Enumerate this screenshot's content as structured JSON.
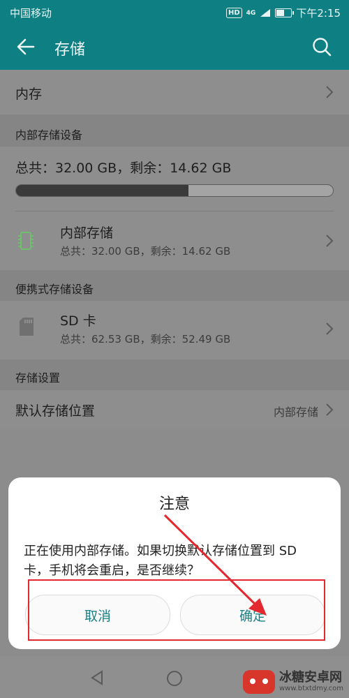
{
  "status_bar": {
    "carrier": "中国移动",
    "hd": "HD",
    "signal_text": "4G",
    "time": "下午2:15"
  },
  "app_bar": {
    "title": "存储",
    "back_icon": "arrow-left-icon",
    "search_icon": "search-icon"
  },
  "memory_row": {
    "label": "内存"
  },
  "internal_section": {
    "header": "内部存储设备",
    "summary": "总共：32.00 GB，剩余：14.62 GB",
    "used_fraction": 0.543,
    "item": {
      "name": "内部存储",
      "detail": "总共：32.00 GB，剩余：14.62 GB"
    }
  },
  "portable_section": {
    "header": "便携式存储设备",
    "item": {
      "name": "SD 卡",
      "detail": "总共：62.53 GB，剩余：52.49 GB"
    }
  },
  "settings_section": {
    "header": "存储设置",
    "default_location": {
      "label": "默认存储位置",
      "value": "内部存储"
    }
  },
  "dialog": {
    "title": "注意",
    "message": "正在使用内部存储。如果切换默认存储位置到 SD 卡，手机将会重启，是否继续？",
    "cancel": "取消",
    "confirm": "确定"
  },
  "watermark": {
    "name": "冰糖安卓网",
    "url": "www.btxtdmy.com"
  },
  "colors": {
    "accent": "#0e7f83",
    "highlight": "#e3282f"
  }
}
